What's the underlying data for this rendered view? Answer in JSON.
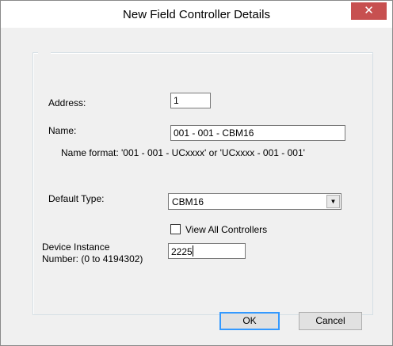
{
  "window": {
    "title": "New Field Controller Details",
    "close_glyph": "✕",
    "close_color": "#c75050"
  },
  "form": {
    "address_label": "Address:",
    "address_value": "1",
    "name_label": "Name:",
    "name_value": "001 - 001 - CBM16",
    "name_format_hint": "Name format: '001 - 001 - UCxxxx' or 'UCxxxx - 001 - 001'",
    "default_type_label": "Default Type:",
    "default_type_value": "CBM16",
    "dropdown_glyph": "▼",
    "view_all_label": "View All Controllers",
    "view_all_checked": false,
    "device_instance_label_line1": "Device Instance",
    "device_instance_label_line2": "Number: (0 to 4194302)",
    "device_instance_value": "2225"
  },
  "buttons": {
    "ok_label": "OK",
    "cancel_label": "Cancel"
  }
}
